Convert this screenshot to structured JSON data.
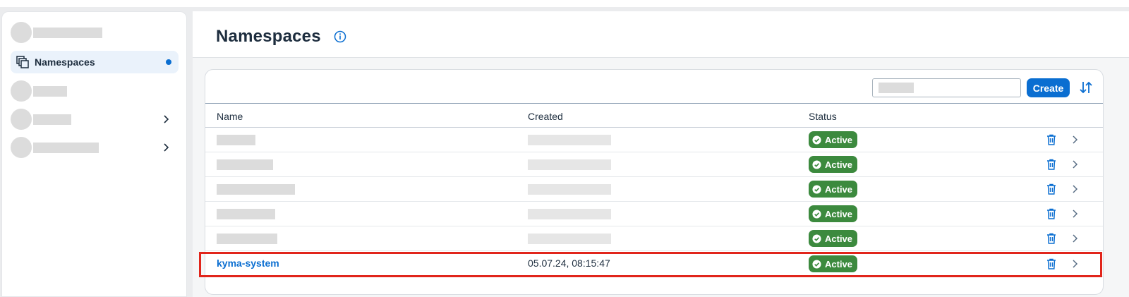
{
  "sidebar": {
    "items": [
      {
        "type": "placeholder"
      },
      {
        "label": "Namespaces",
        "icon": "namespaces-icon",
        "active": true
      },
      {
        "type": "placeholder"
      },
      {
        "type": "placeholder",
        "expandable": true
      },
      {
        "type": "placeholder",
        "expandable": true
      }
    ]
  },
  "header": {
    "title": "Namespaces",
    "info_icon": "info-icon"
  },
  "toolbar": {
    "search_placeholder": "",
    "create_label": "Create",
    "sort_icon": "sort-icon"
  },
  "table": {
    "columns": [
      "Name",
      "Created",
      "Status"
    ],
    "rows": [
      {
        "name": "",
        "created": "",
        "status": "Active"
      },
      {
        "name": "",
        "created": "",
        "status": "Active"
      },
      {
        "name": "",
        "created": "",
        "status": "Active"
      },
      {
        "name": "",
        "created": "",
        "status": "Active"
      },
      {
        "name": "",
        "created": "",
        "status": "Active"
      },
      {
        "name": "kyma-system",
        "created": "05.07.24, 08:15:47",
        "status": "Active",
        "highlighted": true
      }
    ]
  },
  "colors": {
    "accent": "#0a6ed1",
    "status_active": "#3c8a3e",
    "highlight": "#e1251b"
  }
}
